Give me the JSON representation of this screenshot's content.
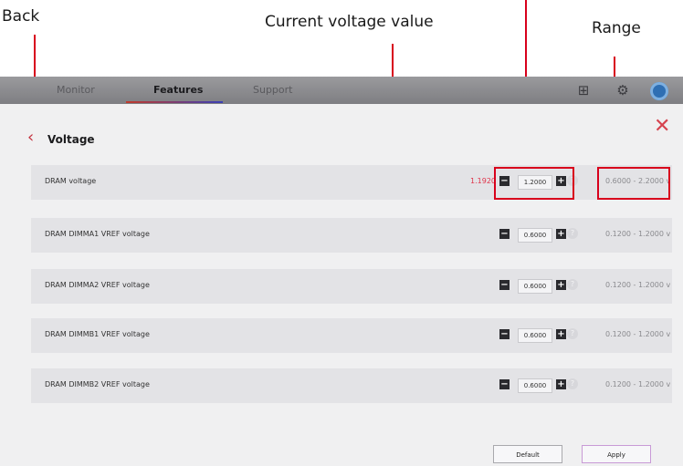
{
  "annotations": {
    "back": "Back",
    "current_voltage": "Current voltage value",
    "range": "Range"
  },
  "tabs": [
    {
      "label": "Monitor"
    },
    {
      "label": "Features"
    },
    {
      "label": "Support"
    }
  ],
  "page": {
    "title": "Voltage"
  },
  "rows": [
    {
      "label": "DRAM voltage",
      "current": "1.1920",
      "value": "1.2000",
      "range": "0.6000 - 2.2000 v"
    },
    {
      "label": "DRAM DIMMA1 VREF voltage",
      "current": "",
      "value": "0.6000",
      "range": "0.1200 - 1.2000 v"
    },
    {
      "label": "DRAM DIMMA2 VREF voltage",
      "current": "",
      "value": "0.6000",
      "range": "0.1200 - 1.2000 v"
    },
    {
      "label": "DRAM DIMMB1 VREF voltage",
      "current": "",
      "value": "0.6000",
      "range": "0.1200 - 1.2000 v"
    },
    {
      "label": "DRAM DIMMB2 VREF voltage",
      "current": "",
      "value": "0.6000",
      "range": "0.1200 - 1.2000 v"
    }
  ],
  "buttons": {
    "default": "Default",
    "apply": "Apply"
  },
  "icons": {
    "back": "chevron-left-icon",
    "close": "close-icon",
    "grid": "grid-icon",
    "settings": "gear-icon",
    "avatar": "avatar-icon",
    "minus": "minus-icon",
    "plus": "plus-icon",
    "help": "help-icon"
  },
  "colors": {
    "accent": "#d8001c",
    "current_value": "#e0344a"
  }
}
